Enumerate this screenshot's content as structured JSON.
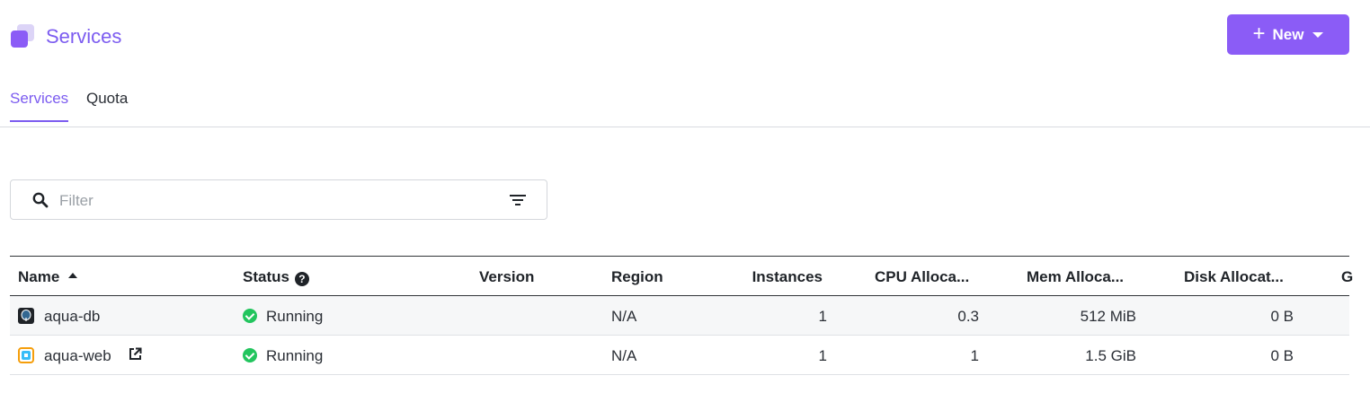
{
  "header": {
    "title": "Services",
    "new_button": {
      "label": "New",
      "icon": "plus-icon"
    }
  },
  "tabs": [
    {
      "label": "Services",
      "active": true
    },
    {
      "label": "Quota",
      "active": false
    }
  ],
  "filter": {
    "placeholder": "Filter",
    "value": ""
  },
  "table": {
    "columns": [
      "Name",
      "Status",
      "Version",
      "Region",
      "Instances",
      "CPU Alloca...",
      "Mem Alloca...",
      "Disk Allocat...",
      "G"
    ],
    "sorted_column": "Name",
    "rows": [
      {
        "name": "aqua-db",
        "icon": "postgres-icon",
        "status": "Running",
        "version": "",
        "region": "N/A",
        "instances": "1",
        "cpu": "0.3",
        "mem": "512 MiB",
        "disk": "0 B",
        "external_link": false
      },
      {
        "name": "aqua-web",
        "icon": "web-app-icon",
        "status": "Running",
        "version": "",
        "region": "N/A",
        "instances": "1",
        "cpu": "1",
        "mem": "1.5 GiB",
        "disk": "0 B",
        "external_link": true
      }
    ]
  },
  "colors": {
    "accent": "#8b5cf6",
    "success": "#22c55e"
  }
}
